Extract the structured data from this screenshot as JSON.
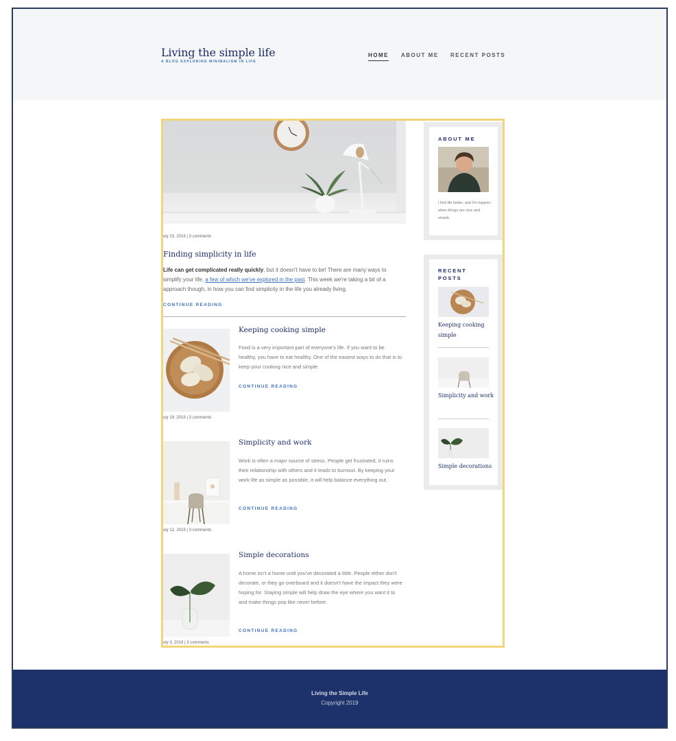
{
  "site": {
    "title": "Living the simple life",
    "subtitle": "A BLOG EXPLORING MINIMALISM IN LIFE"
  },
  "nav": {
    "home": "HOME",
    "about": "ABOUT ME",
    "recent": "RECENT POSTS"
  },
  "featured": {
    "meta": "uly 23, 2019 | 3 comments",
    "title": "Finding simplicity in life",
    "excerpt_bold": "Life can get complicated really quickly",
    "excerpt_pre": ", but it doesn't have to be! There are many ways to simplify your life, ",
    "excerpt_link": "a few of which we've explored in the past",
    "excerpt_post": ". This week we're taking a bit of a approach though, in how you can find simplicity in the life you already living.",
    "continue": "CONTINUE READING"
  },
  "posts": [
    {
      "title": "Keeping cooking simple",
      "excerpt": "Food is a very important part of everyone's life. If you want to be healthy, you have to eat healthy. One of the easiest ways to do that is to keep your cooking nice and simple.",
      "continue": "CONTINUE READING",
      "meta": "uly 19, 2019 | 3 comments"
    },
    {
      "title": "Simplicity and work",
      "excerpt": "Work is often a major source of stress. People get frustrated, it ruins their relationship with others and it leads to burnout. By keeping your work life as simple as possible, it will help balance everything out.",
      "continue": "CONTINUE READING",
      "meta": "uly 12, 2019 | 3 comments"
    },
    {
      "title": "Simple decorations",
      "excerpt": "A home isn't a home until you've decorated a little. People either don't decorate, or they go overboard and it doesn't have the impact they were hoping for. Staying simple will help draw the eye where you want it to and make things pop like never before.",
      "continue": "CONTINUE READING",
      "meta": "uly 3, 2019 | 3 comments"
    }
  ],
  "sidebar": {
    "about_heading": "ABOUT ME",
    "about_text": "I find life better, and I'm happier, when things are nice and simple.",
    "recent_heading": "RECENT POSTS",
    "recent_posts": [
      "Keeping cooking simple",
      "Simplicity and work",
      "Simple decorations"
    ]
  },
  "footer": {
    "title": "Living the Simple Life",
    "copyright": "Copyright 2019"
  },
  "colors": {
    "navy": "#1d2e6b",
    "accent_blue": "#3b6fc1",
    "footer_bg": "#1d326b",
    "highlight_border": "#f1d57a"
  }
}
